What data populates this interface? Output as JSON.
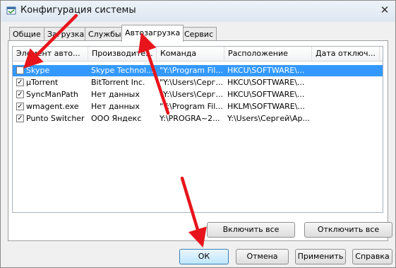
{
  "window": {
    "title": "Конфигурация системы",
    "close_glyph": "✕"
  },
  "tabs": [
    {
      "label": "Общие"
    },
    {
      "label": "Загрузка"
    },
    {
      "label": "Службы"
    },
    {
      "label": "Автозагрузка",
      "active": true
    },
    {
      "label": "Сервис"
    }
  ],
  "startup_list": {
    "columns": [
      "Элемент авто...",
      "Производите...",
      "Команда",
      "Расположение",
      "Дата отключ..."
    ],
    "rows": [
      {
        "checked": false,
        "selected": true,
        "item": "Skype",
        "maker": "Skype Technol...",
        "command": "\"Y:\\Program Fil...",
        "location": "HKCU\\SOFTWARE\\...",
        "date": ""
      },
      {
        "checked": true,
        "selected": false,
        "item": "µTorrent",
        "maker": "BitTorrent Inc.",
        "command": "\"Y:\\Users\\Серг...",
        "location": "HKCU\\SOFTWARE\\...",
        "date": ""
      },
      {
        "checked": true,
        "selected": false,
        "item": "SyncManPath",
        "maker": "Нет данных",
        "command": "\"Y:\\Users\\Серг...",
        "location": "HKCU\\SOFTWARE\\...",
        "date": ""
      },
      {
        "checked": true,
        "selected": false,
        "item": "wmagent.exe",
        "maker": "Нет данных",
        "command": "\"Y:\\Program Fil...",
        "location": "HKLM\\SOFTWARE\\...",
        "date": ""
      },
      {
        "checked": true,
        "selected": false,
        "item": "Punto Switcher",
        "maker": "ООО Яндекс",
        "command": "Y:\\PROGRA~2...",
        "location": "Y:\\Users\\Сергей\\Ap...",
        "date": ""
      }
    ]
  },
  "panel_buttons": {
    "enable_all": "Включить все",
    "disable_all": "Отключить все"
  },
  "dialog_buttons": {
    "ok": "ОК",
    "cancel": "Отмена",
    "apply": "Применить",
    "help": "Справка"
  },
  "colors": {
    "selection": "#3399ff",
    "annotation_arrow": "#e8141b"
  }
}
